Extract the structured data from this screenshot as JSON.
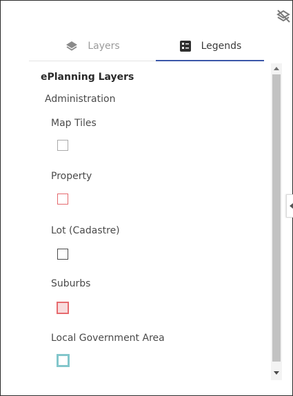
{
  "tabs": {
    "layers": {
      "label": "Layers",
      "icon": "layers-icon"
    },
    "legends": {
      "label": "Legends",
      "icon": "legend-icon",
      "active": true
    }
  },
  "corner": {
    "icon": "layers-hidden-icon"
  },
  "legend": {
    "heading": "ePlanning Layers",
    "group": "Administration",
    "items": [
      {
        "label": "Map Tiles",
        "swatch_border": "#a9a9a9",
        "swatch_fill": "#ffffff"
      },
      {
        "label": "Property",
        "swatch_border": "#e4686c",
        "swatch_fill": "#ffffff"
      },
      {
        "label": "Lot (Cadastre)",
        "swatch_border": "#4a4a4a",
        "swatch_fill": "#ffffff"
      },
      {
        "label": "Suburbs",
        "swatch_border": "#e66a6e",
        "swatch_fill": "#f8dcdd"
      },
      {
        "label": "Local Government Area",
        "swatch_border": "#82c6cb",
        "swatch_fill": "#ffffff"
      }
    ]
  },
  "colors": {
    "accent": "#3a56a8",
    "inactive_tab": "#9a9a9a"
  }
}
